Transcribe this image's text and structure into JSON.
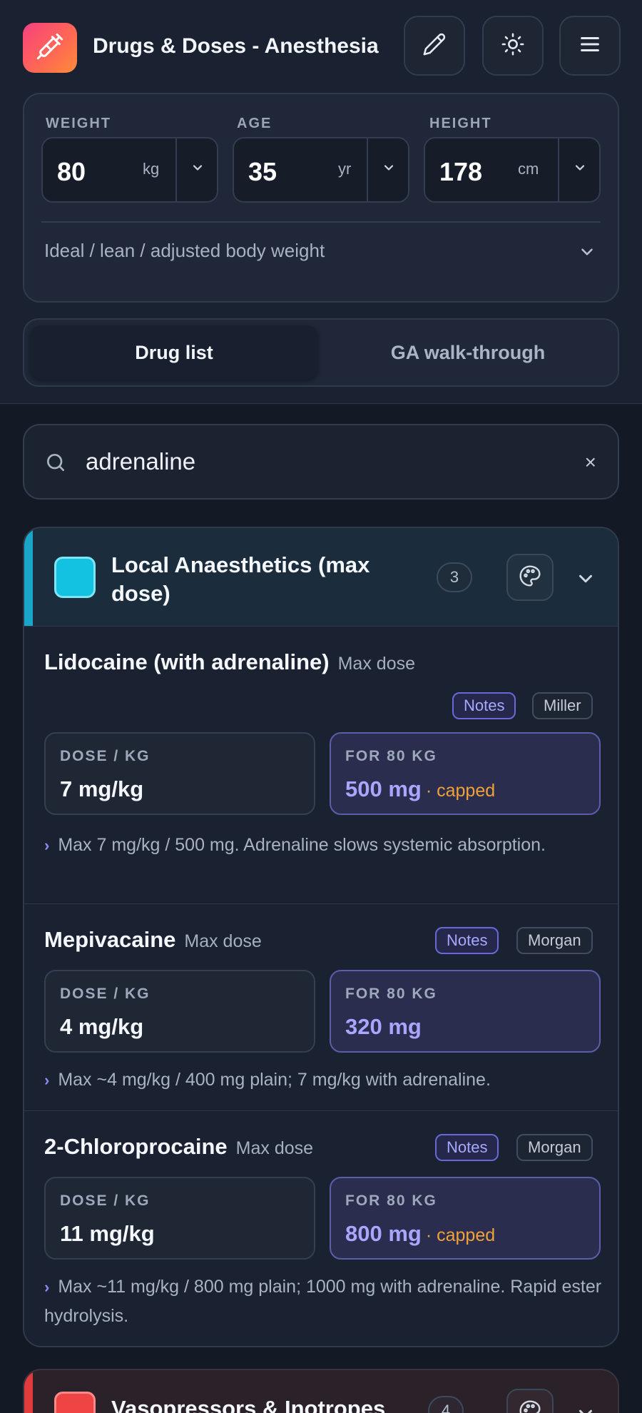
{
  "header": {
    "title": "Drugs & Doses - Anesthesia",
    "buttons": [
      {
        "icon": "pencil-icon"
      },
      {
        "icon": "sun-icon"
      },
      {
        "icon": "menu-icon"
      }
    ]
  },
  "patient": {
    "weight": {
      "label": "WEIGHT",
      "value": "80",
      "unit": "kg"
    },
    "age": {
      "label": "AGE",
      "value": "35",
      "unit": "yr"
    },
    "height": {
      "label": "HEIGHT",
      "value": "178",
      "unit": "cm"
    },
    "body_weight_toggle": "Ideal / lean / adjusted body weight"
  },
  "tabs": {
    "active": "Drug list",
    "inactive": "GA walk-through"
  },
  "search": {
    "value": "adrenaline",
    "clear": "×"
  },
  "groups": [
    {
      "title": "Local Anaesthetics (max dose)",
      "count": "3",
      "accent": "#1aa6c8",
      "drugs": [
        {
          "name": "Lidocaine (with adrenaline)",
          "type": "Max dose",
          "tags": {
            "notes": "Notes",
            "ref": "Miller"
          },
          "dose_label": "DOSE / KG",
          "dose": "7 mg/kg",
          "total_label": "FOR 80 KG",
          "total": "500 mg",
          "capped": "· capped",
          "note": "Max 7 mg/kg / 500 mg. Adrenaline slows systemic absorption."
        },
        {
          "name": "Mepivacaine",
          "type": "Max dose",
          "tags": {
            "notes": "Notes",
            "ref": "Morgan"
          },
          "dose_label": "DOSE / KG",
          "dose": "4 mg/kg",
          "total_label": "FOR 80 KG",
          "total": "320 mg",
          "note": "Max ~4 mg/kg / 400 mg plain; 7 mg/kg with adrenaline."
        },
        {
          "name": "2-Chloroprocaine",
          "type": "Max dose",
          "tags": {
            "notes": "Notes",
            "ref": "Morgan"
          },
          "dose_label": "DOSE / KG",
          "dose": "11 mg/kg",
          "total_label": "FOR 80 KG",
          "total": "800 mg",
          "capped": "· capped",
          "note": "Max ~11 mg/kg / 800 mg plain; 1000 mg with adrenaline. Rapid ester hydrolysis."
        }
      ]
    },
    {
      "title": "Vasopressors & Inotropes",
      "count": "4",
      "accent": "#e23b3b"
    }
  ],
  "colors": {
    "background": "#141a25",
    "accent_notes": "#a7a9ff",
    "capped": "#f0a13a"
  }
}
